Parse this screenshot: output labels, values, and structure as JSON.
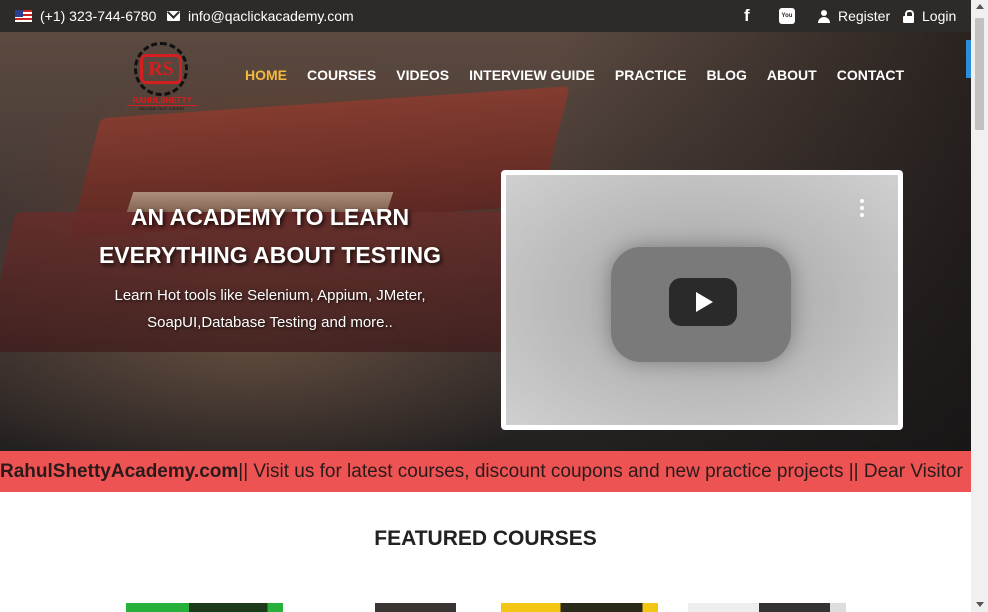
{
  "topbar": {
    "phone": "(+1) 323-744-6780",
    "email": "info@qaclickacademy.com",
    "facebook_glyph": "f",
    "youtube_glyph": "You Tube",
    "register": "Register",
    "login": "Login"
  },
  "logo": {
    "mark": "RS",
    "name": "RAHULSHETTY",
    "tagline": "BECOME TEST EXPERT"
  },
  "nav": [
    {
      "label": "HOME",
      "active": true
    },
    {
      "label": "COURSES"
    },
    {
      "label": "VIDEOS"
    },
    {
      "label": "INTERVIEW GUIDE"
    },
    {
      "label": "PRACTICE"
    },
    {
      "label": "BLOG"
    },
    {
      "label": "ABOUT"
    },
    {
      "label": "CONTACT"
    }
  ],
  "hero": {
    "title_line1": "AN ACADEMY TO LEARN",
    "title_line2": "EVERYTHING ABOUT TESTING",
    "sub_line1": "Learn Hot tools like Selenium, Appium, JMeter,",
    "sub_line2": "SoapUI,Database Testing and more.."
  },
  "marquee": {
    "brand": "RahulShettyAcademy.com",
    "text": " || Visit us for latest courses, discount coupons and new practice projects || Dear Visitor"
  },
  "featured": {
    "title": "FEATURED COURSES"
  },
  "colors": {
    "topbar": "#2e2a27",
    "accent": "#f4b93d",
    "marquee": "#ed5353",
    "logo_red": "#d31f1f"
  }
}
